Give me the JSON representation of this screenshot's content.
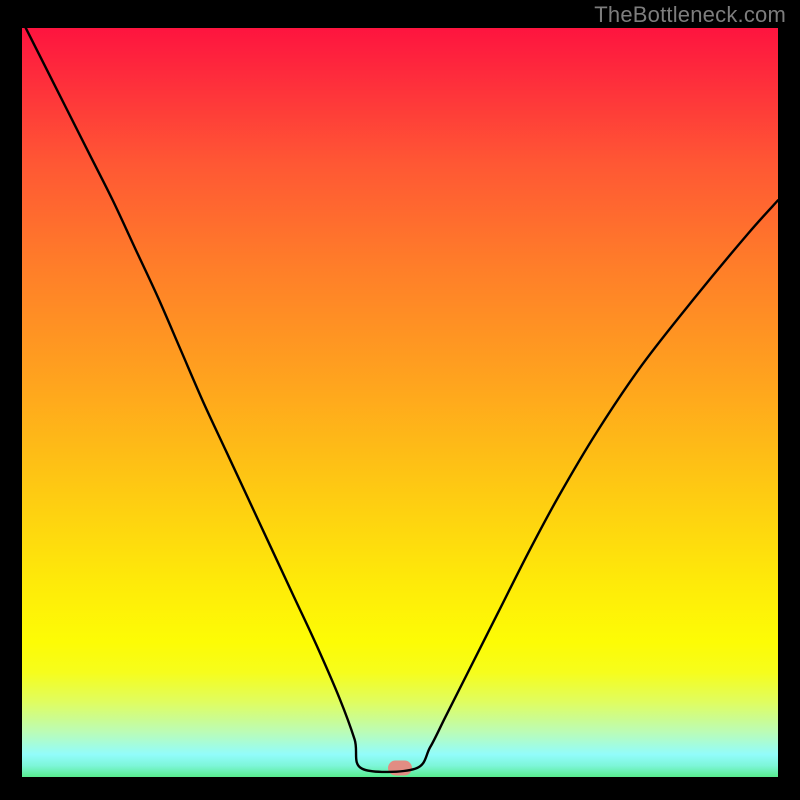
{
  "watermark_text": "TheBottleneck.com",
  "colors": {
    "background": "#000000",
    "curve": "#000000",
    "marker": "#e28d83",
    "watermark": "#7d7d7d",
    "gradient_top": "#fe143f",
    "gradient_bottom": "#57ec8e"
  },
  "chart_data": {
    "type": "line",
    "title": "",
    "xlabel": "",
    "ylabel": "",
    "xlim": [
      0,
      100
    ],
    "ylim": [
      0,
      100
    ],
    "grid": false,
    "legend": false,
    "flat_segment": {
      "x0": 45,
      "x1": 52,
      "y": 1.1
    },
    "marker": {
      "x": 50,
      "y": 1.2
    },
    "series": [
      {
        "name": "bottleneck-curve",
        "x": [
          0,
          3,
          6,
          9,
          12,
          15,
          18,
          21,
          24,
          27,
          30,
          33,
          36,
          39,
          42,
          44,
          45,
          52,
          54,
          56,
          59,
          63,
          67,
          71,
          76,
          82,
          89,
          96,
          100
        ],
        "y": [
          101,
          95,
          89,
          83,
          77,
          70.5,
          64,
          57,
          50,
          43.5,
          37,
          30.5,
          24,
          17.5,
          10.5,
          5,
          1.1,
          1.1,
          4,
          8,
          14,
          22,
          30,
          37.5,
          46,
          55,
          64,
          72.5,
          77
        ]
      }
    ],
    "annotations": []
  }
}
